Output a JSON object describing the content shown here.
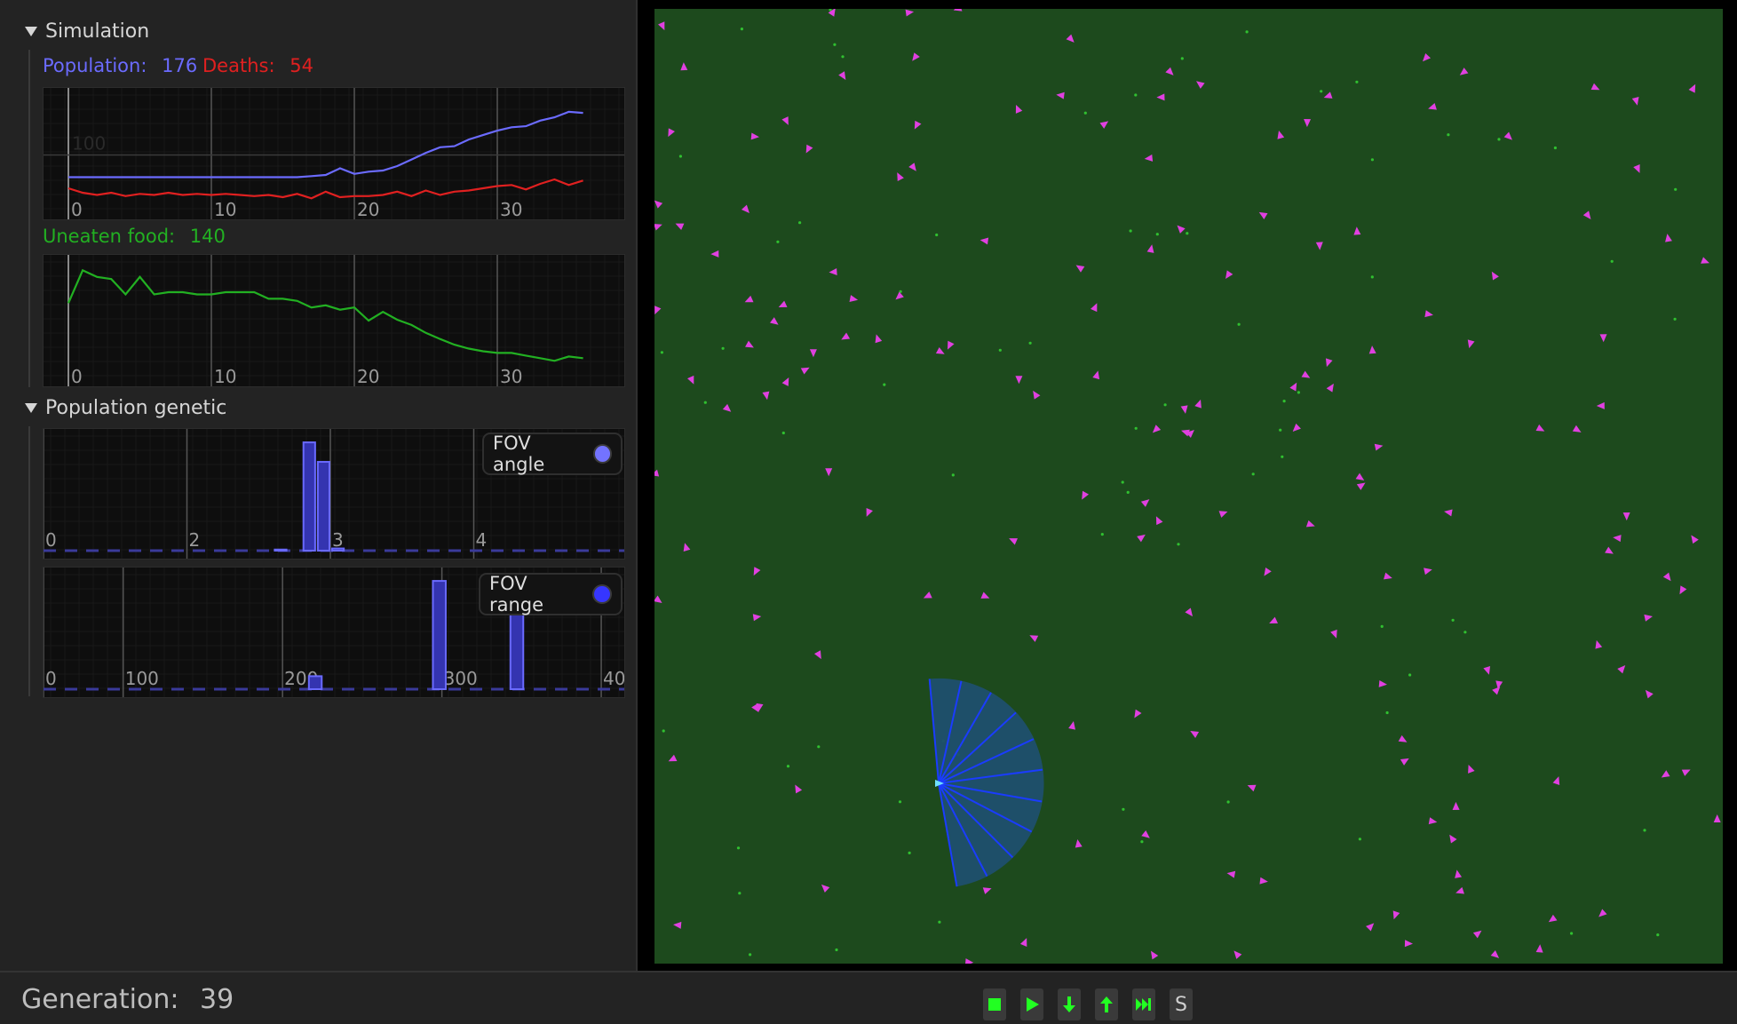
{
  "sidebar": {
    "simulation_header": "Simulation",
    "population_label": "Population:",
    "population_value": "176",
    "deaths_label": "Deaths:",
    "deaths_value": "54",
    "uneaten_label": "Uneaten food:",
    "uneaten_value": "140",
    "genetic_header": "Population genetic",
    "fov_angle_legend": "FOV angle",
    "fov_range_legend": "FOV range"
  },
  "colors": {
    "population": "#6b6bff",
    "deaths": "#e02020",
    "food": "#22b022",
    "world_bg": "#1d4a1d",
    "creature": "#e040e0",
    "food_dot": "#30c030",
    "fov_fill": "#1f4f6e",
    "fov_ray": "#1a3cff",
    "button_icon": "#22ff22"
  },
  "chart_data": [
    {
      "type": "line",
      "x_ticks": [
        "0",
        "10",
        "20",
        "30"
      ],
      "y_tick": "100",
      "xlim": [
        0,
        37.5
      ],
      "ylim": [
        0,
        205
      ],
      "series": [
        {
          "name": "Population:",
          "x": [
            0,
            1,
            2,
            3,
            4,
            5,
            6,
            7,
            8,
            9,
            10,
            11,
            12,
            13,
            14,
            15,
            16,
            17,
            18,
            19,
            20,
            21,
            22,
            23,
            24,
            25,
            26,
            27,
            28,
            29,
            30,
            31,
            32,
            33,
            34,
            35,
            36
          ],
          "values": [
            60,
            60,
            60,
            60,
            60,
            60,
            60,
            60,
            60,
            60,
            60,
            60,
            60,
            60,
            60,
            60,
            60,
            62,
            64,
            76,
            66,
            70,
            72,
            80,
            92,
            104,
            114,
            116,
            128,
            136,
            144,
            150,
            152,
            162,
            168,
            178,
            176
          ]
        },
        {
          "name": "Deaths:",
          "x": [
            0,
            1,
            2,
            3,
            4,
            5,
            6,
            7,
            8,
            9,
            10,
            11,
            12,
            13,
            14,
            15,
            16,
            17,
            18,
            19,
            20,
            21,
            22,
            23,
            24,
            25,
            26,
            27,
            28,
            29,
            30,
            31,
            32,
            33,
            34,
            35,
            36
          ],
          "values": [
            40,
            32,
            28,
            32,
            26,
            30,
            28,
            32,
            28,
            30,
            28,
            30,
            28,
            26,
            28,
            24,
            30,
            22,
            34,
            24,
            26,
            26,
            28,
            34,
            26,
            36,
            28,
            34,
            36,
            40,
            44,
            46,
            38,
            48,
            56,
            46,
            54
          ]
        }
      ]
    },
    {
      "type": "line",
      "x_ticks": [
        "0",
        "10",
        "20",
        "30"
      ],
      "xlim": [
        0,
        37.5
      ],
      "ylim": [
        130,
        390
      ],
      "series": [
        {
          "name": "Uneaten food:",
          "x": [
            0,
            1,
            2,
            3,
            4,
            5,
            6,
            7,
            8,
            9,
            10,
            11,
            12,
            13,
            14,
            15,
            16,
            17,
            18,
            19,
            20,
            21,
            22,
            23,
            24,
            25,
            26,
            27,
            28,
            29,
            30,
            31,
            32,
            33,
            34,
            35,
            36
          ],
          "values": [
            300,
            375,
            360,
            355,
            320,
            360,
            320,
            325,
            325,
            320,
            320,
            325,
            325,
            325,
            310,
            310,
            305,
            290,
            295,
            285,
            290,
            260,
            280,
            262,
            250,
            232,
            218,
            205,
            196,
            190,
            186,
            186,
            180,
            174,
            168,
            178,
            174
          ]
        }
      ]
    },
    {
      "type": "bar",
      "series_name": "FOV angle",
      "x_ticks": [
        "0",
        "2",
        "3",
        "4"
      ],
      "tick_positions": [
        1.0,
        2.0,
        3.0,
        4.0
      ],
      "x_first": 1.0,
      "x_last": 4.9,
      "bin_width": 0.1,
      "values": [
        0,
        0,
        0,
        0,
        0,
        0,
        0,
        0,
        0,
        0,
        0,
        0,
        0,
        0,
        0,
        0,
        1,
        0,
        100,
        82,
        2,
        0,
        0,
        0,
        0,
        0,
        0,
        0,
        0,
        0,
        0,
        0,
        0,
        0,
        0,
        0,
        0,
        0,
        0,
        0
      ],
      "ylim": [
        0,
        105
      ]
    },
    {
      "type": "bar",
      "series_name": "FOV range",
      "x_ticks": [
        "0",
        "100",
        "200",
        "300",
        "40"
      ],
      "tick_positions": [
        50,
        100,
        200,
        300,
        400
      ],
      "x_first": 50,
      "x_last": 400,
      "bin_width": 10,
      "values": [
        0,
        0,
        0,
        0,
        0,
        0,
        0,
        0,
        0,
        0,
        0,
        0,
        0,
        0,
        0,
        0,
        0,
        12,
        0,
        0,
        0,
        0,
        0,
        0,
        0,
        100,
        0,
        0,
        0,
        0,
        80,
        0,
        0,
        0,
        0,
        0,
        0
      ],
      "ylim": [
        0,
        105
      ]
    }
  ],
  "status": {
    "generation_label": "Generation:",
    "generation_value": "39"
  },
  "controls": [
    {
      "name": "stop-button",
      "icon": "stop-icon"
    },
    {
      "name": "play-button",
      "icon": "play-icon"
    },
    {
      "name": "step-down-button",
      "icon": "arrow-down-icon"
    },
    {
      "name": "step-up-button",
      "icon": "arrow-up-icon"
    },
    {
      "name": "fast-forward-button",
      "icon": "skip-forward-icon"
    },
    {
      "name": "s-button",
      "label": "S"
    }
  ]
}
